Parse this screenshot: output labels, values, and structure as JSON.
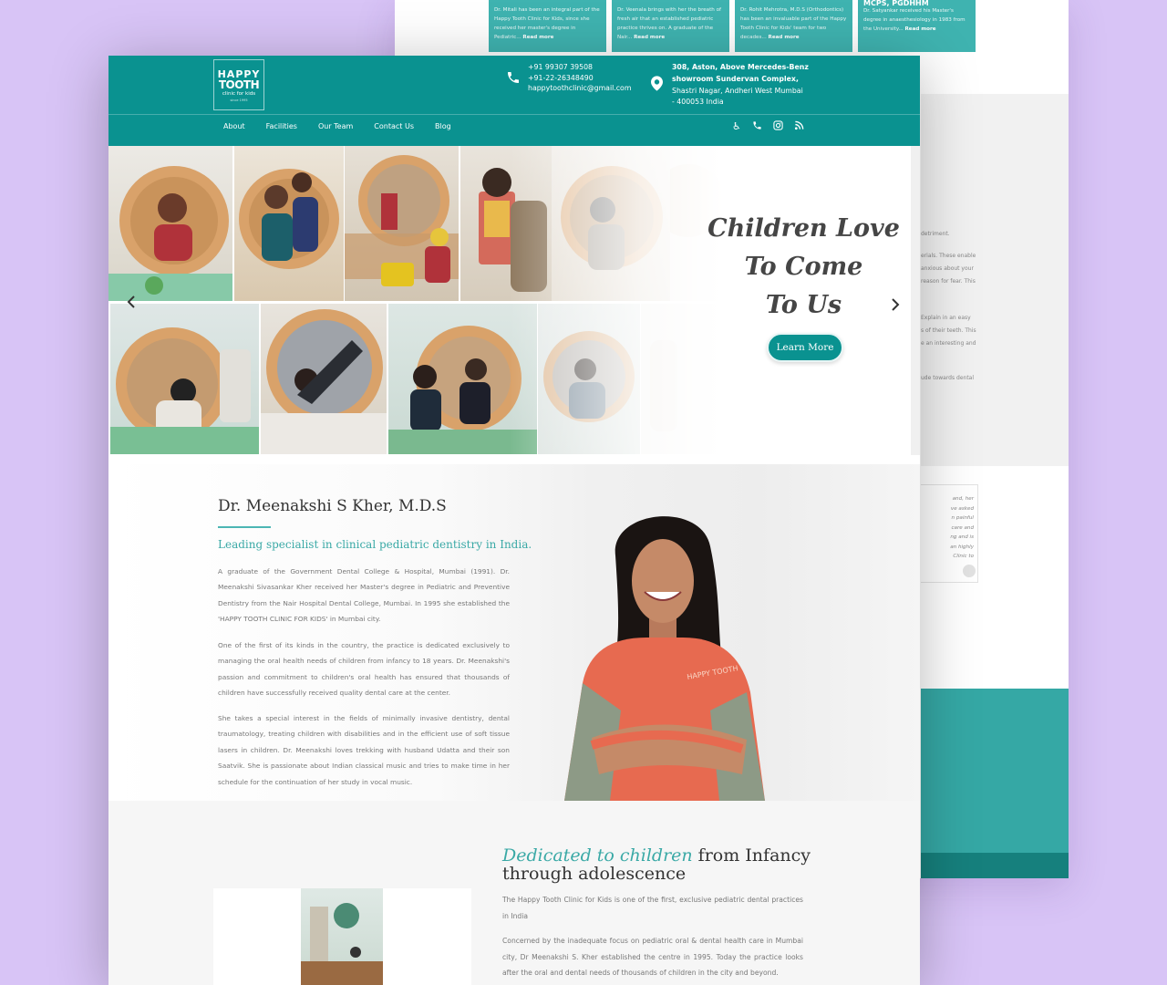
{
  "back_page": {
    "cards": [
      {
        "title": "",
        "text": "Dr. Mitali has been an integral part of the Happy Tooth Clinic for Kids, since she received her master's degree in Pediatric...",
        "more": "Read more"
      },
      {
        "title": "",
        "text": "Dr. Veenala brings with her the breath of fresh air that an established pediatric practice thrives on. A graduate of the Nair...",
        "more": "Read more"
      },
      {
        "title": "",
        "text": "Dr. Rohit Mehrotra, M.D.S (Orthodontics) has been an invaluable part of the Happy Tooth Clinic for Kids' team for two decades...",
        "more": "Read more"
      },
      {
        "title": "MCPS, PGDHHM",
        "text": "Dr. Satyankar received his Master's degree in anaesthesiology in 1983 from the University...",
        "more": "Read more"
      }
    ],
    "grey_lines": [
      "detriment.",
      "erials. These enable",
      "anxious about your",
      "reason for fear. This",
      "Explain in an easy",
      "s of their teeth. This",
      "e an interesting and",
      "ude towards dental"
    ],
    "quote_lines": [
      "and, her",
      "ve asked",
      "n painful",
      "care and",
      "ng and is",
      "an highly",
      "Clinic to"
    ]
  },
  "header": {
    "logo": {
      "line1": "HAPPY",
      "line2": "TOOTH",
      "line3": "clinic for kids",
      "line4": "since 1995"
    },
    "phone1": "+91 99307 39508",
    "phone2": "+91-22-26348490",
    "email": "happytoothclinic@gmail.com",
    "address1": "308, Aston, Above Mercedes-Benz",
    "address2": "showroom Sundervan Complex,",
    "address3": "Shastri Nagar, Andheri West Mumbai",
    "address4": "- 400053 India",
    "nav": [
      "About",
      "Facilities",
      "Our Team",
      "Contact Us",
      "Blog"
    ]
  },
  "hero": {
    "line1": "Children Love",
    "line2": "To Come",
    "line3": "To Us",
    "button": "Learn More"
  },
  "doctor": {
    "name": "Dr. Meenakshi S Kher, M.D.S",
    "tagline": "Leading specialist in clinical pediatric dentistry in India.",
    "para1": "A graduate of the Government Dental College & Hospital, Mumbai (1991). Dr. Meenakshi Sivasankar Kher received her Master's degree in Pediatric and Preventive Dentistry from the Nair Hospital Dental College, Mumbai. In 1995 she established the 'HAPPY TOOTH CLINIC FOR KIDS' in Mumbai city.",
    "para2": "One of the first of its kinds in the country, the practice is dedicated exclusively to managing the oral health needs of children from infancy to 18 years. Dr. Meenakshi's passion and commitment to children's oral health has ensured that thousands of children have successfully received quality dental care at the center.",
    "para3": "She takes a special interest in the fields of minimally invasive dentistry, dental traumatology, treating children with disabilities and in the efficient use of soft tissue lasers in children. Dr. Meenakshi loves trekking with husband Udatta and their son Saatvik. She is passionate about Indian classical music and tries to make time in her schedule for the continuation of her study in vocal music.",
    "shirt_logo": "HAPPY TOOTH"
  },
  "dedicated": {
    "title_em": "Dedicated to children",
    "title_rest": " from Infancy through adolescence",
    "para1": "The Happy Tooth Clinic for Kids is one of the first, exclusive pediatric dental practices in India",
    "para2": "Concerned by the inadequate focus on pediatric oral & dental health care in Mumbai city, Dr Meenakshi S. Kher established the centre in 1995. Today the practice looks after the oral and dental needs of thousands of children in the city and beyond."
  },
  "colors": {
    "teal": "#0a9290",
    "teal_light": "#3fb3b0",
    "accent_text": "#3aa9a6",
    "background": "#d8c4f6"
  }
}
